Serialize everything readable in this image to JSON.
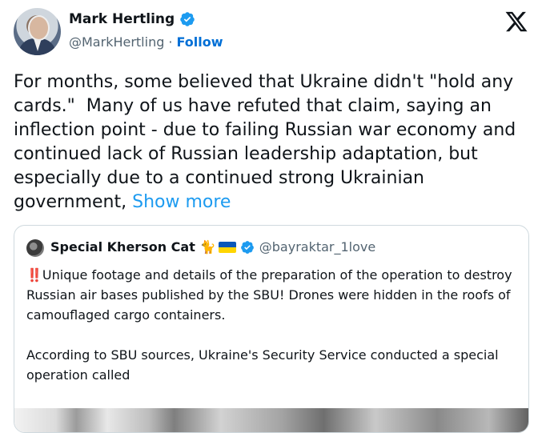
{
  "author": {
    "name": "Mark Hertling",
    "handle": "@MarkHertling",
    "separator": "·",
    "follow_label": "Follow",
    "avatar_icon": "profile-photo"
  },
  "tweet": {
    "text": "For months, some believed that Ukraine didn't \"hold any cards.\"  Many of us have refuted that claim, saying an inflection point - due to failing Russian war economy and continued lack of Russian leadership adaptation, but especially due to a continued strong Ukrainian government, ",
    "show_more_label": "Show more"
  },
  "quote": {
    "name": "Special Kherson Cat",
    "emoji": "🐈",
    "handle": "@bayraktar_1love",
    "alert_icon": "‼️",
    "text_line1": "Unique footage and details of the preparation of the operation to destroy Russian air bases published by the SBU! Drones were hidden in the roofs of camouflaged cargo containers.",
    "text_line2": "According to SBU sources, Ukraine's Security Service conducted a special operation called"
  },
  "colors": {
    "link": "#1d9bf0",
    "follow": "#006fd6",
    "verified": "#1d9bf0",
    "secondary_text": "#536471",
    "border": "#cfd9de"
  },
  "icons": {
    "verified": "verified-badge-icon",
    "x_logo": "x-logo-icon",
    "flag": "ukraine-flag-icon"
  }
}
